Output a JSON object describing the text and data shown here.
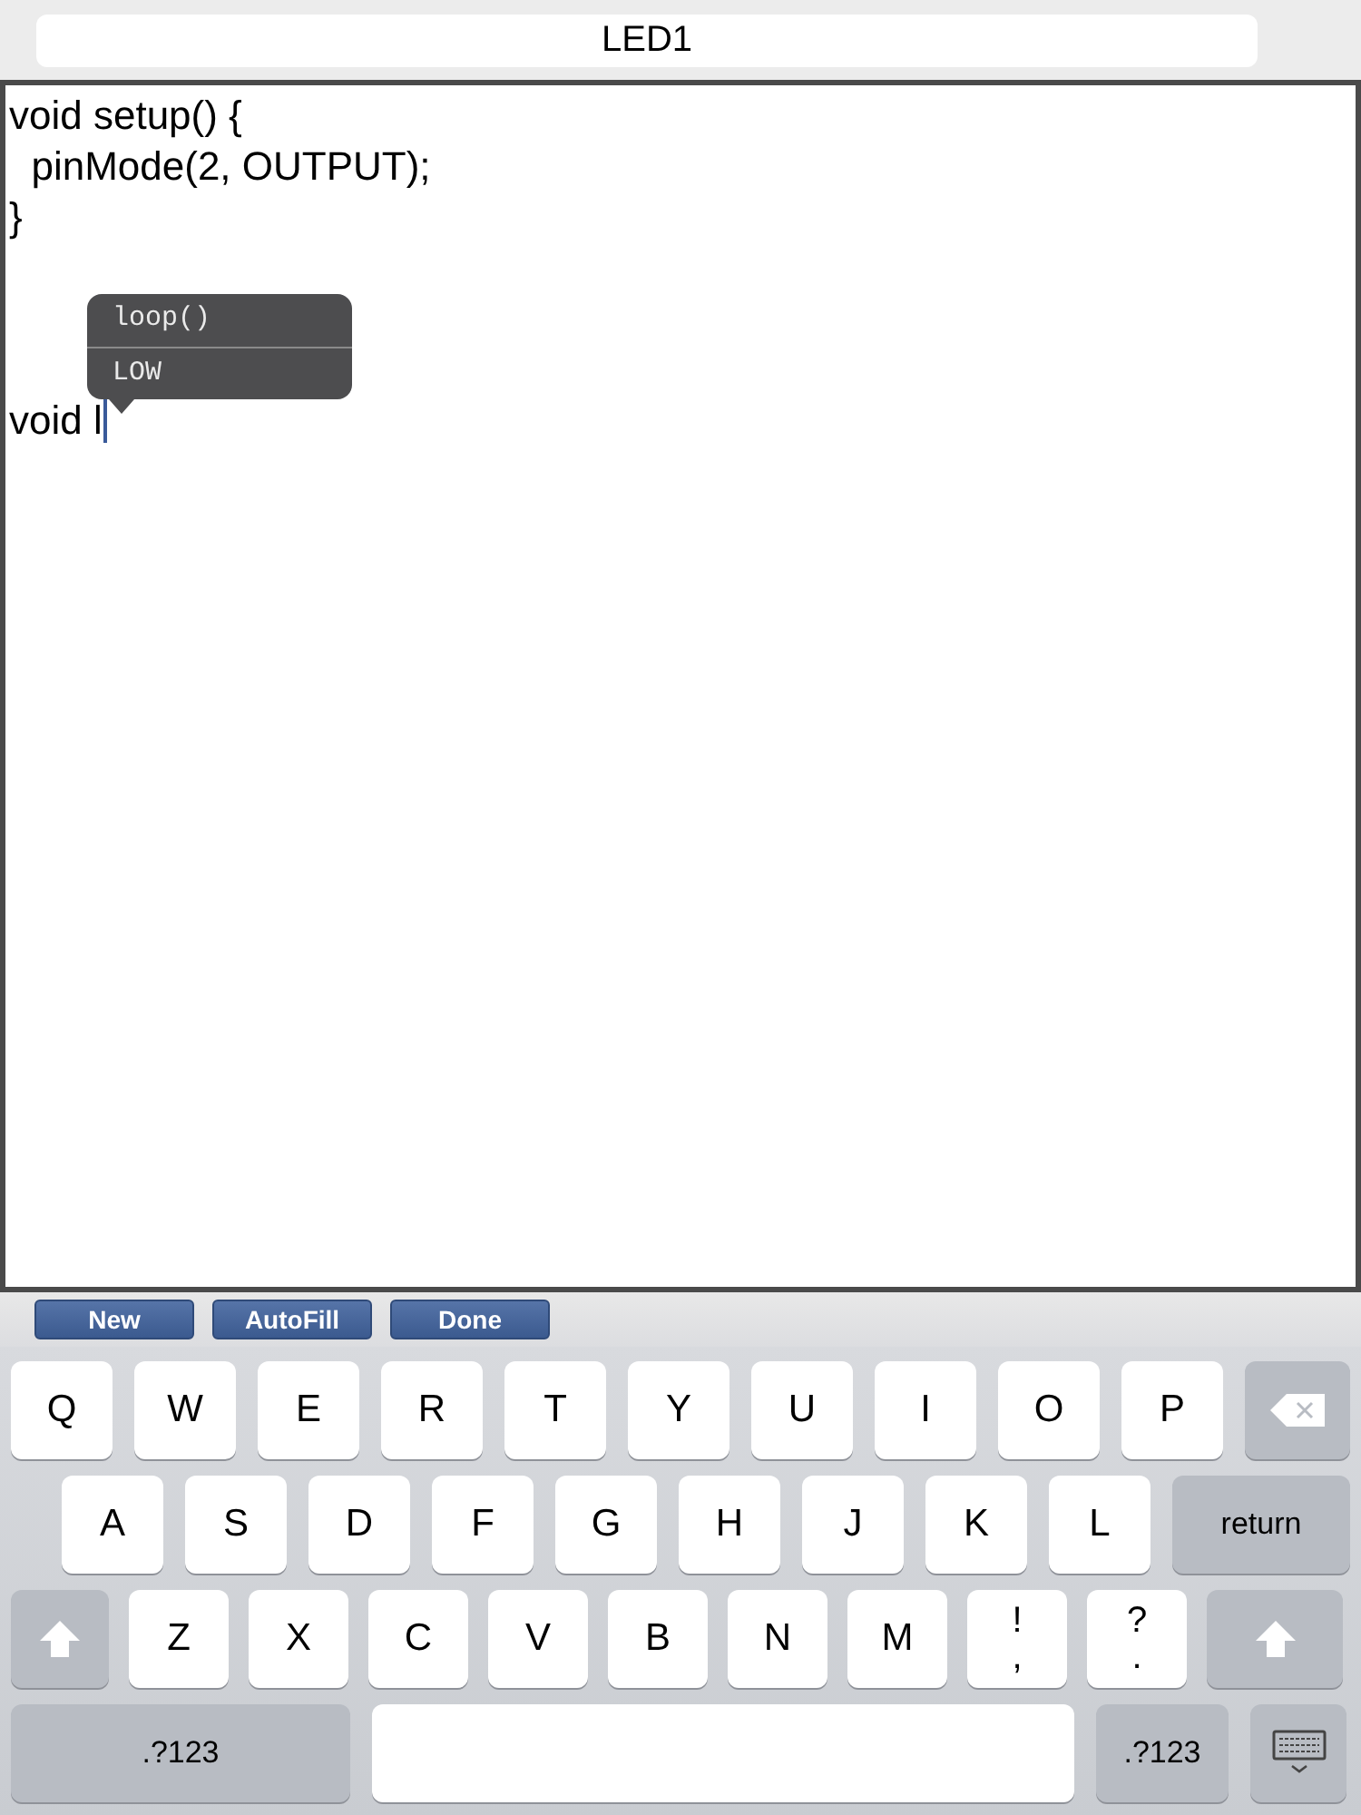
{
  "title": "LED1",
  "code": "void setup() {\n  pinMode(2, OUTPUT);\n}\n\n\n\nvoid l",
  "suggestions": [
    {
      "label": "loop()",
      "selected": false
    },
    {
      "label": "LOW",
      "selected": false
    }
  ],
  "toolbar": [
    "New",
    "AutoFill",
    "Done"
  ],
  "keyboard": {
    "rows": [
      {
        "keys": [
          {
            "kind": "letter",
            "label": "Q"
          },
          {
            "kind": "letter",
            "label": "W"
          },
          {
            "kind": "letter",
            "label": "E"
          },
          {
            "kind": "letter",
            "label": "R"
          },
          {
            "kind": "letter",
            "label": "T"
          },
          {
            "kind": "letter",
            "label": "Y"
          },
          {
            "kind": "letter",
            "label": "U"
          },
          {
            "kind": "letter",
            "label": "I"
          },
          {
            "kind": "letter",
            "label": "O"
          },
          {
            "kind": "letter",
            "label": "P"
          },
          {
            "kind": "backspace"
          }
        ]
      },
      {
        "keys": [
          {
            "kind": "letter",
            "label": "A"
          },
          {
            "kind": "letter",
            "label": "S"
          },
          {
            "kind": "letter",
            "label": "D"
          },
          {
            "kind": "letter",
            "label": "F"
          },
          {
            "kind": "letter",
            "label": "G"
          },
          {
            "kind": "letter",
            "label": "H"
          },
          {
            "kind": "letter",
            "label": "J"
          },
          {
            "kind": "letter",
            "label": "K"
          },
          {
            "kind": "letter",
            "label": "L"
          },
          {
            "kind": "return",
            "label": "return"
          }
        ]
      },
      {
        "keys": [
          {
            "kind": "shift"
          },
          {
            "kind": "letter",
            "label": "Z"
          },
          {
            "kind": "letter",
            "label": "X"
          },
          {
            "kind": "letter",
            "label": "C"
          },
          {
            "kind": "letter",
            "label": "V"
          },
          {
            "kind": "letter",
            "label": "B"
          },
          {
            "kind": "letter",
            "label": "N"
          },
          {
            "kind": "letter",
            "label": "M"
          },
          {
            "kind": "dual",
            "top": "!",
            "bottom": ","
          },
          {
            "kind": "dual",
            "top": "?",
            "bottom": "."
          },
          {
            "kind": "shift"
          }
        ]
      },
      {
        "keys": [
          {
            "kind": "mode",
            "label": ".?123"
          },
          {
            "kind": "space"
          },
          {
            "kind": "mode",
            "label": ".?123"
          },
          {
            "kind": "hide"
          }
        ]
      }
    ]
  }
}
